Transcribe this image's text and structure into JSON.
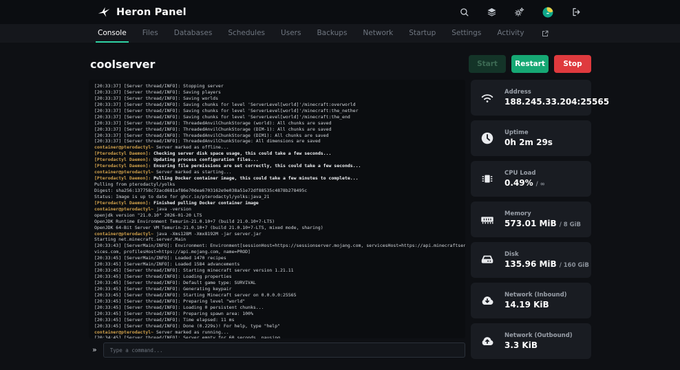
{
  "colors": {
    "accent": "#2fd3a5",
    "restart_bg": "#16a874",
    "stop_bg": "#df3a3e",
    "start_disabled_bg": "#143428",
    "console_gold": "#d2a24c",
    "avatar_teal": "#0fa88a",
    "avatar_yellow": "#e8d24a"
  },
  "header": {
    "app_name": "Heron Panel",
    "logo_icon": "heron-logo-icon",
    "action_icons": [
      {
        "icon": "search",
        "name": "search-icon"
      },
      {
        "icon": "layers",
        "name": "layers-icon"
      },
      {
        "icon": "gears",
        "name": "gears-icon"
      },
      {
        "icon": "avatar",
        "name": "user-avatar"
      },
      {
        "icon": "logout",
        "name": "logout-icon"
      }
    ]
  },
  "nav": {
    "tabs": [
      {
        "label": "Console",
        "active": true
      },
      {
        "label": "Files",
        "active": false
      },
      {
        "label": "Databases",
        "active": false
      },
      {
        "label": "Schedules",
        "active": false
      },
      {
        "label": "Users",
        "active": false
      },
      {
        "label": "Backups",
        "active": false
      },
      {
        "label": "Network",
        "active": false
      },
      {
        "label": "Startup",
        "active": false
      },
      {
        "label": "Settings",
        "active": false
      },
      {
        "label": "Activity",
        "active": false
      }
    ],
    "external_link_icon": "external-link-icon"
  },
  "server": {
    "name": "coolserver",
    "actions": {
      "start": "Start",
      "restart": "Restart",
      "stop": "Stop"
    }
  },
  "console": {
    "prompt": "»",
    "command_placeholder": "Type a command...",
    "lines": [
      {
        "p": "",
        "t": "[20:33:37] [Server thread/INFO]: Stopping server"
      },
      {
        "p": "",
        "t": "[20:33:37] [Server thread/INFO]: Saving players"
      },
      {
        "p": "",
        "t": "[20:33:37] [Server thread/INFO]: Saving worlds"
      },
      {
        "p": "",
        "t": "[20:33:37] [Server thread/INFO]: Saving chunks for level 'ServerLevel[world]'/minecraft:overworld"
      },
      {
        "p": "",
        "t": "[20:33:37] [Server thread/INFO]: Saving chunks for level 'ServerLevel[world]'/minecraft:the_nether"
      },
      {
        "p": "",
        "t": "[20:33:37] [Server thread/INFO]: Saving chunks for level 'ServerLevel[world]'/minecraft:the_end"
      },
      {
        "p": "",
        "t": "[20:33:37] [Server thread/INFO]: ThreadedAnvilChunkStorage (world): All chunks are saved"
      },
      {
        "p": "",
        "t": "[20:33:37] [Server thread/INFO]: ThreadedAnvilChunkStorage (DIM-1): All chunks are saved"
      },
      {
        "p": "",
        "t": "[20:33:37] [Server thread/INFO]: ThreadedAnvilChunkStorage (DIM1): All chunks are saved"
      },
      {
        "p": "",
        "t": "[20:33:37] [Server thread/INFO]: ThreadedAnvilChunkStorage: All dimensions are saved"
      },
      {
        "p": "container@pterodactyl~",
        "t": " Server marked as offline...",
        "kind": "container"
      },
      {
        "p": "[Pterodactyl Daemon]:",
        "t": " Checking server disk space usage, this could take a few seconds...",
        "kind": "daemon"
      },
      {
        "p": "[Pterodactyl Daemon]:",
        "t": " Updating process configuration files...",
        "kind": "daemon"
      },
      {
        "p": "[Pterodactyl Daemon]:",
        "t": " Ensuring file permissions are set correctly, this could take a few seconds...",
        "kind": "daemon"
      },
      {
        "p": "container@pterodactyl~",
        "t": " Server marked as starting...",
        "kind": "container"
      },
      {
        "p": "[Pterodactyl Daemon]:",
        "t": " Pulling Docker container image, this could take a few minutes to complete...",
        "kind": "daemon"
      },
      {
        "p": "",
        "t": "Pulling from pterodactyl/yolks"
      },
      {
        "p": "",
        "t": "Digest: sha256:137758c72acd681af86e70dea6703162e9e038a51e72df88535c4878b278495c"
      },
      {
        "p": "",
        "t": "Status: Image is up to date for ghcr.io/pterodactyl/yolks:java_21"
      },
      {
        "p": "[Pterodactyl Daemon]:",
        "t": " Finished pulling Docker container image",
        "kind": "daemon"
      },
      {
        "p": "container@pterodactyl~",
        "t": " java -version",
        "kind": "container"
      },
      {
        "p": "",
        "t": "openjdk version \"21.0.10\" 2026-01-20 LTS"
      },
      {
        "p": "",
        "t": "OpenJDK Runtime Environment Temurin-21.0.10+7 (build 21.0.10+7-LTS)"
      },
      {
        "p": "",
        "t": "OpenJDK 64-Bit Server VM Temurin-21.0.10+7 (build 21.0.10+7-LTS, mixed mode, sharing)"
      },
      {
        "p": "container@pterodactyl~",
        "t": " java -Xms128M -Xmx8192M -jar server.jar",
        "kind": "container"
      },
      {
        "p": "",
        "t": "Starting net.minecraft.server.Main"
      },
      {
        "p": "",
        "t": "[20:33:43] [ServerMain/INFO]: Environment: Environment[sessionHost=https://sessionserver.mojang.com, servicesHost=https://api.minecraftser"
      },
      {
        "p": "",
        "t": "vices.com, profilesHost=https://api.mojang.com, name=PROD]"
      },
      {
        "p": "",
        "t": "[20:33:45] [ServerMain/INFO]: Loaded 1470 recipes"
      },
      {
        "p": "",
        "t": "[20:33:45] [ServerMain/INFO]: Loaded 1584 advancements"
      },
      {
        "p": "",
        "t": "[20:33:45] [Server thread/INFO]: Starting minecraft server version 1.21.11"
      },
      {
        "p": "",
        "t": "[20:33:45] [Server thread/INFO]: Loading properties"
      },
      {
        "p": "",
        "t": "[20:33:45] [Server thread/INFO]: Default game type: SURVIVAL"
      },
      {
        "p": "",
        "t": "[20:33:45] [Server thread/INFO]: Generating keypair"
      },
      {
        "p": "",
        "t": "[20:33:45] [Server thread/INFO]: Starting Minecraft server on 0.0.0.0:25565"
      },
      {
        "p": "",
        "t": "[20:33:45] [Server thread/INFO]: Preparing level \"world\""
      },
      {
        "p": "",
        "t": "[20:33:45] [Server thread/INFO]: Loading 0 persistent chunks..."
      },
      {
        "p": "",
        "t": "[20:33:45] [Server thread/INFO]: Preparing spawn area: 100%"
      },
      {
        "p": "",
        "t": "[20:33:45] [Server thread/INFO]: Time elapsed: 11 ms"
      },
      {
        "p": "",
        "t": "[20:33:45] [Server thread/INFO]: Done (0.229s)! For help, type \"help\""
      },
      {
        "p": "container@pterodactyl~",
        "t": " Server marked as running...",
        "kind": "container"
      },
      {
        "p": "",
        "t": "[20:34:45] [Server thread/INFO]: Server empty for 60 seconds, pausing"
      }
    ]
  },
  "sidebar": {
    "cards": [
      {
        "icon": "wifi",
        "icon_name": "wifi-icon",
        "label": "Address",
        "value": "188.245.33.204:25565",
        "secondary": ""
      },
      {
        "icon": "clock",
        "icon_name": "clock-icon",
        "label": "Uptime",
        "value": "0h 2m 29s",
        "secondary": ""
      },
      {
        "icon": "chip",
        "icon_name": "cpu-chip-icon",
        "label": "CPU Load",
        "value": "0.49%",
        "secondary": "/ ∞"
      },
      {
        "icon": "memory",
        "icon_name": "memory-icon",
        "label": "Memory",
        "value": "573.01 MiB",
        "secondary": "/ 8 GiB"
      },
      {
        "icon": "disk",
        "icon_name": "disk-icon",
        "label": "Disk",
        "value": "135.96 MiB",
        "secondary": "/ 160 GiB"
      },
      {
        "icon": "cloud-down",
        "icon_name": "cloud-download-icon",
        "label": "Network (Inbound)",
        "value": "14.19 KiB",
        "secondary": ""
      },
      {
        "icon": "cloud-up",
        "icon_name": "cloud-upload-icon",
        "label": "Network (Outbound)",
        "value": "3.3 KiB",
        "secondary": ""
      }
    ]
  }
}
